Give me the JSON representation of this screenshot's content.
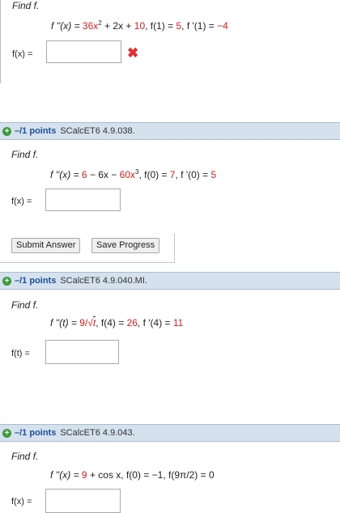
{
  "q1": {
    "find": "Find f.",
    "given_pre": "f ''(x) = ",
    "given_a": "36x",
    "given_sup": "2",
    "given_b": " + 2x + ",
    "given_c": "10",
    "given_d": ",   f(1) = ",
    "given_e": "5",
    "given_f": ",   f '(1) = ",
    "given_g": "−4",
    "label": "f(x) =",
    "value": ""
  },
  "q2": {
    "points": "–/1 points",
    "code": "SCalcET6 4.9.038.",
    "find": "Find f.",
    "given_pre": "f ''(x) = ",
    "given_a": "6",
    "given_b": " − 6x − ",
    "given_c": "60x",
    "given_sup": "3",
    "given_d": ",   f(0) = ",
    "given_e": "7",
    "given_f": ",   f '(0) = ",
    "given_g": "5",
    "label": "f(x) =",
    "value": ""
  },
  "buttons": {
    "submit": "Submit Answer",
    "save": "Save Progress"
  },
  "q3": {
    "points": "–/1 points",
    "code": "SCalcET6 4.9.040.MI.",
    "find": "Find f.",
    "given_pre": "f ''(t) = ",
    "given_a": "9/",
    "given_root": "√",
    "given_t": "t",
    "given_d": ",   f(4) = ",
    "given_e": "26",
    "given_f": ",   f '(4) = ",
    "given_g": "11",
    "label": "f(t) =",
    "value": ""
  },
  "q4": {
    "points": "–/1 points",
    "code": "SCalcET6 4.9.043.",
    "find": "Find f.",
    "given_pre": "f ''(x) = ",
    "given_a": "9",
    "given_b": " + cos x,   f(0) = −1,   f(9π/2) = 0",
    "label": "f(x) =",
    "value": ""
  },
  "colors": {
    "accent_red": "#d02020",
    "header_bg": "#d5e1ed",
    "points_blue": "#1f4f9b"
  },
  "icons": {
    "status": "incorrect-x-icon",
    "expand": "plus-circle-icon"
  }
}
